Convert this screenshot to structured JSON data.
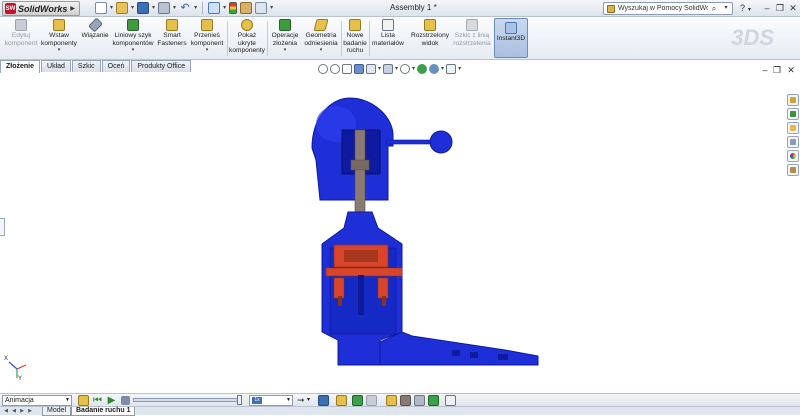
{
  "app": {
    "logo_text": "SolidWorks",
    "logo_mark": "SW",
    "document_title": "Assembly 1 *",
    "search_placeholder": "Wyszukaj w Pomocy SolidWorks",
    "help_label": "?",
    "minimize": "–",
    "restore": "❐",
    "close": "✕"
  },
  "quick_access": [
    "new-document-icon",
    "open-icon",
    "save-icon",
    "print-icon",
    "undo-icon",
    "select-icon",
    "rebuild-icon",
    "file-properties-icon",
    "options-icon"
  ],
  "command_manager": {
    "items": [
      {
        "id": "edit-component",
        "label": "Edytuj\nkomponent",
        "disabled": true
      },
      {
        "id": "insert-components",
        "label": "Wstaw\nkomponenty",
        "caret": true
      },
      {
        "id": "mate",
        "label": "Wiązanie"
      },
      {
        "id": "linear-pattern",
        "label": "Liniowy szyk\nkomponentów",
        "caret": true
      },
      {
        "id": "smart-fasteners",
        "label": "Smart\nFasteners"
      },
      {
        "id": "move-component",
        "label": "Przenieś\nkomponent",
        "caret": true
      },
      {
        "id": "show-hidden",
        "label": "Pokaż\nukryte\nkomponenty"
      },
      {
        "id": "assembly-features",
        "label": "Operacje\nzłożenia",
        "caret": true
      },
      {
        "id": "reference-geometry",
        "label": "Geometria\nodniesienia",
        "caret": true
      },
      {
        "id": "new-motion-study",
        "label": "Nowe\nbadanie\nruchu"
      },
      {
        "id": "bill-of-materials",
        "label": "Lista\nmateriałów"
      },
      {
        "id": "exploded-view",
        "label": "Rozstrzelony\nwidok"
      },
      {
        "id": "explode-line-sketch",
        "label": "Szkic z linią\nrozstrzelenia",
        "disabled": true
      },
      {
        "id": "instant3d",
        "label": "Instant3D",
        "active": true
      }
    ],
    "watermark": "3DS"
  },
  "tabs": [
    {
      "label": "Złożenie",
      "active": true
    },
    {
      "label": "Układ"
    },
    {
      "label": "Szkic"
    },
    {
      "label": "Oceń"
    },
    {
      "label": "Produkty Office"
    }
  ],
  "heads_up_view": [
    "zoom-to-fit-icon",
    "zoom-area-icon",
    "previous-view-icon",
    "section-view-icon",
    "view-orientation-icon",
    "display-style-icon",
    "hide-show-icon",
    "edit-appearance-icon",
    "apply-scene-icon",
    "view-settings-icon"
  ],
  "task_pane": [
    "home-icon",
    "design-library-icon",
    "file-explorer-icon",
    "view-palette-icon",
    "appearances-icon",
    "custom-properties-icon"
  ],
  "triad": {
    "x_label": "X",
    "y_label": "Y"
  },
  "model": {
    "body_color": "#1f2fd8",
    "body_dark": "#0d1a9a",
    "shaft_color": "#8a7a74",
    "insert_color": "#d8452a",
    "insert_dark": "#8e2f18"
  },
  "motion_manager": {
    "study_type": "Animacja",
    "playback_speed_label": "1x"
  },
  "bottom_tabs": [
    {
      "label": "Model"
    },
    {
      "label": "Badanie ruchu 1",
      "active": true
    }
  ]
}
